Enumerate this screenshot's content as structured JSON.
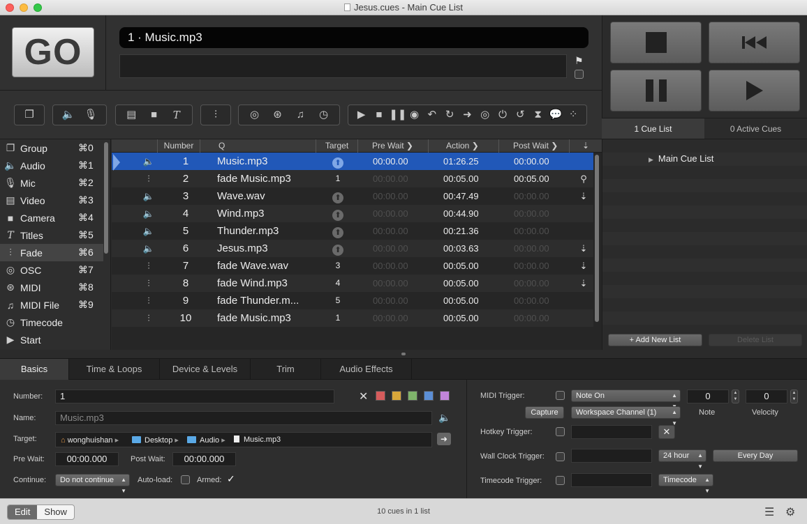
{
  "window": {
    "title": "Jesus.cues - Main Cue List"
  },
  "go": {
    "label": "GO"
  },
  "current_cue": {
    "display": "1 · Music.mp3"
  },
  "cue_lists_tabs": [
    {
      "label": "1 Cue List",
      "active": true
    },
    {
      "label": "0 Active Cues",
      "active": false
    }
  ],
  "sidebar": {
    "items": [
      {
        "label": "Group",
        "shortcut": "⌘0",
        "icon": "group-icon"
      },
      {
        "label": "Audio",
        "shortcut": "⌘1",
        "icon": "speaker-icon"
      },
      {
        "label": "Mic",
        "shortcut": "⌘2",
        "icon": "microphone-icon"
      },
      {
        "label": "Video",
        "shortcut": "⌘3",
        "icon": "film-icon"
      },
      {
        "label": "Camera",
        "shortcut": "⌘4",
        "icon": "camera-icon"
      },
      {
        "label": "Titles",
        "shortcut": "⌘5",
        "icon": "text-icon"
      },
      {
        "label": "Fade",
        "shortcut": "⌘6",
        "icon": "fader-icon",
        "selected": true
      },
      {
        "label": "OSC",
        "shortcut": "⌘7",
        "icon": "osc-icon"
      },
      {
        "label": "MIDI",
        "shortcut": "⌘8",
        "icon": "midi-icon"
      },
      {
        "label": "MIDI File",
        "shortcut": "⌘9",
        "icon": "music-note-icon"
      },
      {
        "label": "Timecode",
        "shortcut": "",
        "icon": "clock-icon"
      },
      {
        "label": "Start",
        "shortcut": "",
        "icon": "play-icon"
      }
    ]
  },
  "table": {
    "headers": {
      "number": "Number",
      "q": "Q",
      "target": "Target",
      "pre_wait": "Pre Wait",
      "action": "Action",
      "post_wait": "Post Wait"
    },
    "rows": [
      {
        "icon": "speaker-icon",
        "number": "1",
        "q": "Music.mp3",
        "target": "",
        "target_kind": "circle",
        "pre": "00:00.00",
        "action": "01:26.25",
        "post": "00:00.00",
        "cont": "",
        "selected": true
      },
      {
        "icon": "fader-icon",
        "number": "2",
        "q": "fade Music.mp3",
        "target": "1",
        "target_kind": "text",
        "pre": "00:00.00",
        "action": "00:05.00",
        "post": "00:05.00",
        "cont": "auto-follow-icon"
      },
      {
        "icon": "speaker-icon",
        "number": "3",
        "q": "Wave.wav",
        "target": "",
        "target_kind": "circle",
        "pre": "00:00.00",
        "action": "00:47.49",
        "post": "00:00.00",
        "cont": "auto-continue-icon"
      },
      {
        "icon": "speaker-icon",
        "number": "4",
        "q": "Wind.mp3",
        "target": "",
        "target_kind": "circle",
        "pre": "00:00.00",
        "action": "00:44.90",
        "post": "00:00.00",
        "cont": ""
      },
      {
        "icon": "speaker-icon",
        "number": "5",
        "q": "Thunder.mp3",
        "target": "",
        "target_kind": "circle",
        "pre": "00:00.00",
        "action": "00:21.36",
        "post": "00:00.00",
        "cont": ""
      },
      {
        "icon": "speaker-icon",
        "number": "6",
        "q": "Jesus.mp3",
        "target": "",
        "target_kind": "circle",
        "pre": "00:00.00",
        "action": "00:03.63",
        "post": "00:00.00",
        "cont": "auto-continue-icon"
      },
      {
        "icon": "fader-icon",
        "number": "7",
        "q": "fade Wave.wav",
        "target": "3",
        "target_kind": "text",
        "pre": "00:00.00",
        "action": "00:05.00",
        "post": "00:00.00",
        "cont": "auto-continue-icon"
      },
      {
        "icon": "fader-icon",
        "number": "8",
        "q": "fade Wind.mp3",
        "target": "4",
        "target_kind": "text",
        "pre": "00:00.00",
        "action": "00:05.00",
        "post": "00:00.00",
        "cont": "auto-continue-icon"
      },
      {
        "icon": "fader-icon",
        "number": "9",
        "q": "fade Thunder.m...",
        "target": "5",
        "target_kind": "text",
        "pre": "00:00.00",
        "action": "00:05.00",
        "post": "00:00.00",
        "cont": ""
      },
      {
        "icon": "fader-icon",
        "number": "10",
        "q": "fade Music.mp3",
        "target": "1",
        "target_kind": "text",
        "pre": "00:00.00",
        "action": "00:05.00",
        "post": "00:00.00",
        "cont": ""
      }
    ]
  },
  "lists": {
    "main_list": "Main Cue List",
    "add_label": "+ Add New List",
    "delete_label": "Delete List"
  },
  "inspector": {
    "tabs": [
      "Basics",
      "Time & Loops",
      "Device & Levels",
      "Trim",
      "Audio Effects"
    ],
    "active_tab": "Basics",
    "labels": {
      "number": "Number:",
      "name": "Name:",
      "target": "Target:",
      "pre_wait": "Pre Wait:",
      "post_wait": "Post Wait:",
      "continue": "Continue:",
      "auto_load": "Auto-load:",
      "armed": "Armed:",
      "midi_trigger": "MIDI Trigger:",
      "hotkey_trigger": "Hotkey Trigger:",
      "wall_clock_trigger": "Wall Clock Trigger:",
      "timecode_trigger": "Timecode Trigger:",
      "note": "Note",
      "velocity": "Velocity"
    },
    "values": {
      "number": "1",
      "name_placeholder": "Music.mp3",
      "pre_wait": "00:00.000",
      "post_wait": "00:00.000",
      "continue": "Do not continue",
      "midi_type": "Note On",
      "channel": "Workspace Channel (1)",
      "note": "0",
      "velocity": "0",
      "capture": "Capture",
      "hour_mode": "24 hour",
      "every_day": "Every Day",
      "timecode": "Timecode",
      "armed_mark": "✓"
    },
    "target_path": [
      "wonghuishan",
      "Desktop",
      "Audio",
      "Music.mp3"
    ],
    "colors": [
      "#d65c5c",
      "#d9a73a",
      "#7fb36b",
      "#5c8fd6",
      "#c185d9"
    ]
  },
  "bottom": {
    "edit": "Edit",
    "show": "Show",
    "status": "10 cues in 1 list"
  }
}
